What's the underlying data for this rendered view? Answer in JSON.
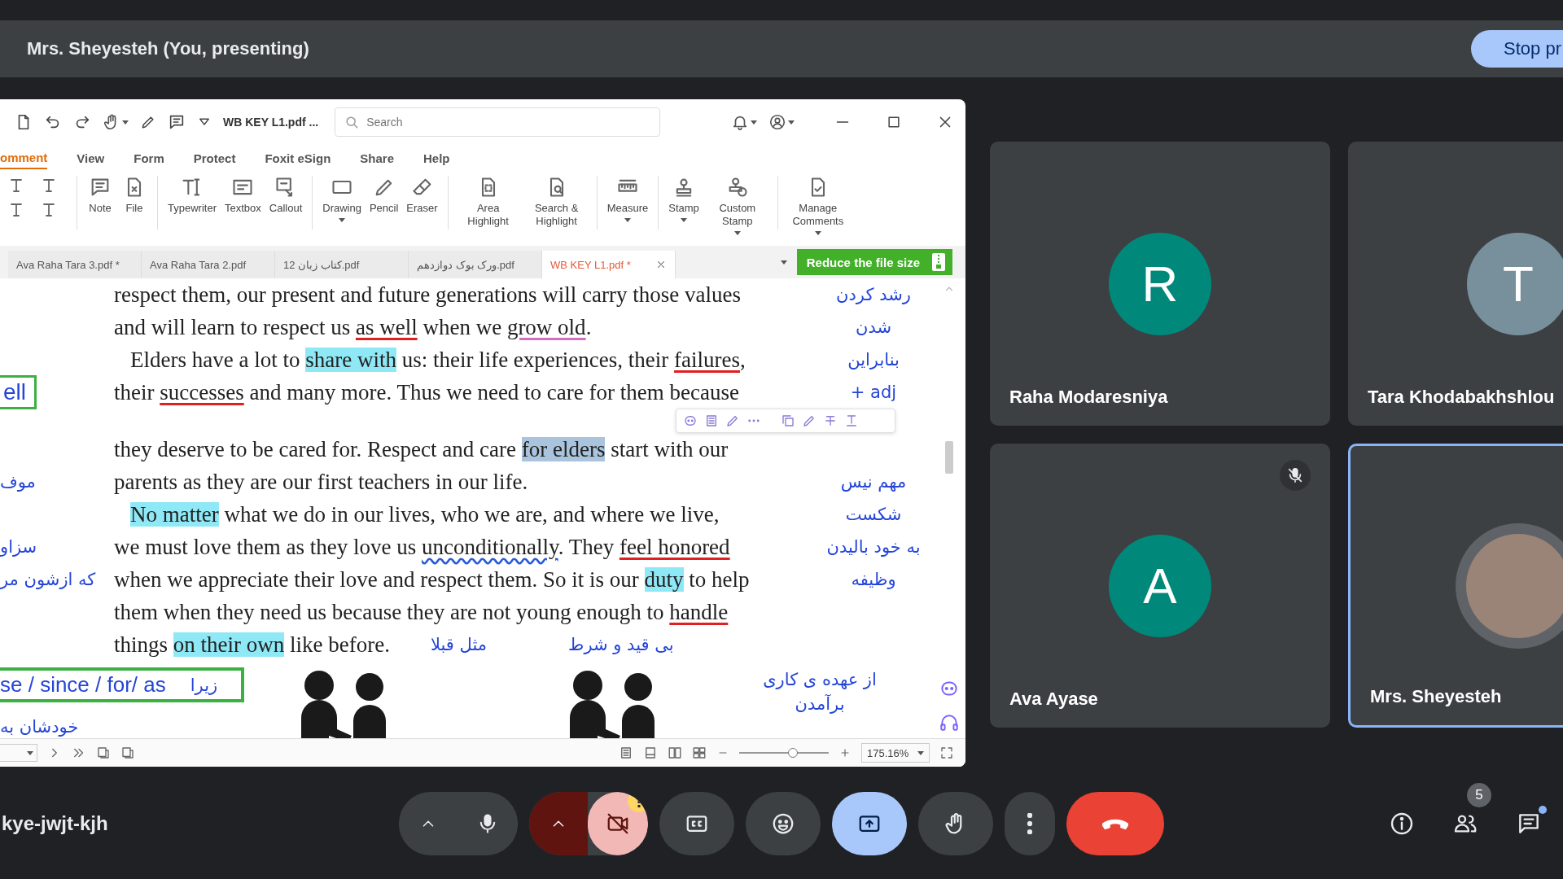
{
  "header": {
    "title": "Mrs. Sheyesteh (You, presenting)",
    "stop_button": "Stop pr"
  },
  "pdf_window": {
    "file_title": "WB KEY L1.pdf ...",
    "search": {
      "placeholder": "Search"
    },
    "menu": [
      {
        "label": "omment",
        "selected": true
      },
      {
        "label": "View",
        "selected": false
      },
      {
        "label": "Form",
        "selected": false
      },
      {
        "label": "Protect",
        "selected": false
      },
      {
        "label": "Foxit eSign",
        "selected": false
      },
      {
        "label": "Share",
        "selected": false
      },
      {
        "label": "Help",
        "selected": false
      }
    ],
    "ribbon": [
      {
        "label": "Note",
        "dropdown": false
      },
      {
        "label": "File",
        "dropdown": false
      },
      {
        "label": "Typewriter",
        "dropdown": false
      },
      {
        "label": "Textbox",
        "dropdown": false
      },
      {
        "label": "Callout",
        "dropdown": false
      },
      {
        "label": "Drawing",
        "dropdown": true
      },
      {
        "label": "Pencil",
        "dropdown": false
      },
      {
        "label": "Eraser",
        "dropdown": false
      },
      {
        "label": "Area Highlight",
        "dropdown": false
      },
      {
        "label": "Search & Highlight",
        "dropdown": false
      },
      {
        "label": "Measure",
        "dropdown": true
      },
      {
        "label": "Stamp",
        "dropdown": true
      },
      {
        "label": "Custom Stamp",
        "dropdown": true
      },
      {
        "label": "Manage Comments",
        "dropdown": true
      }
    ],
    "tabs": [
      {
        "label": "Ava Raha Tara 3.pdf *",
        "selected": false
      },
      {
        "label": "Ava Raha Tara 2.pdf",
        "selected": false
      },
      {
        "label": "کتاب زبان 12.pdf",
        "selected": false
      },
      {
        "label": "ورک بوک دوازدهم.pdf",
        "selected": false
      },
      {
        "label": "WB KEY L1.pdf *",
        "selected": true
      }
    ],
    "reduce_button": "Reduce the file size",
    "document": {
      "lines": [
        {
          "indent": false,
          "segments": [
            {
              "text": "respect them, our present and future generations will carry those values",
              "kind": "plain"
            }
          ],
          "right_note": "رشد کردن"
        },
        {
          "indent": false,
          "segments": [
            {
              "text": "and will learn to respect us ",
              "kind": "plain"
            },
            {
              "text": "as well",
              "kind": "underline",
              "color": "#e02020"
            },
            {
              "text": " when we ",
              "kind": "plain"
            },
            {
              "text": "grow old",
              "kind": "underline",
              "color": "#d070c0"
            },
            {
              "text": ".",
              "kind": "plain"
            }
          ],
          "right_note": "شدن"
        },
        {
          "indent": true,
          "segments": [
            {
              "text": "Elders have a lot to ",
              "kind": "plain"
            },
            {
              "text": "share with",
              "kind": "highlight",
              "color": "#8ee8f5"
            },
            {
              "text": " us: their life experiences, their ",
              "kind": "plain"
            },
            {
              "text": "failures",
              "kind": "underline",
              "color": "#e02020"
            },
            {
              "text": ",",
              "kind": "plain"
            }
          ],
          "right_note": "بنابراین"
        },
        {
          "indent": false,
          "segments": [
            {
              "text": "their ",
              "kind": "plain"
            },
            {
              "text": "successes",
              "kind": "underline",
              "color": "#e02020"
            },
            {
              "text": " and many more. Thus we need to care for them because",
              "kind": "plain"
            }
          ],
          "left_note": {
            "text": "ell",
            "boxed": true
          },
          "right_note": "+ adj"
        },
        {
          "indent": false,
          "segments": [
            {
              "text": "they deserve to be cared for. Respect and care ",
              "kind": "plain"
            },
            {
              "text": "for elders",
              "kind": "highlight",
              "color": "#a9c4dc"
            },
            {
              "text": " start with our",
              "kind": "plain"
            }
          ]
        },
        {
          "indent": false,
          "segments": [
            {
              "text": "parents as they are our first teachers in our life.",
              "kind": "plain"
            }
          ],
          "left_note": {
            "text": "موف",
            "boxed": false
          },
          "right_note": "مهم نیس"
        },
        {
          "indent": true,
          "segments": [
            {
              "text": "No matter",
              "kind": "highlight",
              "color": "#8ee8f5"
            },
            {
              "text": " what we do in our lives, who we are, and where we live,",
              "kind": "plain"
            }
          ],
          "right_note": "شکست"
        },
        {
          "indent": false,
          "segments": [
            {
              "text": "we must love them as they love us ",
              "kind": "plain"
            },
            {
              "text": "unconditionally",
              "kind": "squiggle",
              "color": "#2a5bd7"
            },
            {
              "text": ". They ",
              "kind": "plain"
            },
            {
              "text": "feel honored",
              "kind": "underline",
              "color": "#e02020"
            }
          ],
          "left_note": {
            "text": "سزاو",
            "boxed": false
          },
          "right_note": "به خود بالیدن"
        },
        {
          "indent": false,
          "segments": [
            {
              "text": "when we appreciate their love and respect them. So it is our ",
              "kind": "plain"
            },
            {
              "text": "duty",
              "kind": "highlight",
              "color": "#8ee8f5"
            },
            {
              "text": " to help",
              "kind": "plain"
            }
          ],
          "left_note": {
            "text": "که ازشون مر",
            "boxed": false
          },
          "right_note": "وظیفه"
        },
        {
          "indent": false,
          "segments": [
            {
              "text": "them when they need us because they are not young enough to ",
              "kind": "plain"
            },
            {
              "text": "handle",
              "kind": "underline",
              "color": "#e02020"
            }
          ]
        },
        {
          "indent": false,
          "segments": [
            {
              "text": "things ",
              "kind": "plain"
            },
            {
              "text": "on their own",
              "kind": "highlight",
              "color": "#8ee8f5"
            },
            {
              "text": " like before.",
              "kind": "plain"
            }
          ],
          "notes": [
            "بی قید و شرط",
            "مثل قبلا"
          ]
        }
      ],
      "green_box": {
        "english": "se / since / for/ as",
        "persian": "زیرا"
      },
      "bottom_left_note": "خودشان به",
      "bottom_right_note": "از عهده ی کاری برآمدن"
    },
    "status_bar": {
      "zoom": "175.16%",
      "zoom_slider": {
        "level": 0.6
      }
    }
  },
  "tiles": [
    {
      "name": "Raha Modaresniya",
      "avatar": {
        "kind": "letter",
        "letter": "R",
        "color": "#00897b"
      },
      "muted": false,
      "highlighted": false
    },
    {
      "name": "Tara Khodabakhshlou",
      "avatar": {
        "kind": "letter",
        "letter": "T",
        "color": "#78909c"
      },
      "muted": false,
      "highlighted": false
    },
    {
      "name": "Ava Ayase",
      "avatar": {
        "kind": "letter",
        "letter": "A",
        "color": "#00897b"
      },
      "muted": true,
      "highlighted": false
    },
    {
      "name": "Mrs. Sheyesteh",
      "avatar": {
        "kind": "photo"
      },
      "muted": false,
      "highlighted": true
    }
  ],
  "bottom_bar": {
    "meeting_code": "kye-jwjt-kjh",
    "controls": [
      {
        "kind": "mic",
        "on": true
      },
      {
        "kind": "camera",
        "on": false,
        "warning": true
      },
      {
        "kind": "captions",
        "on": false
      },
      {
        "kind": "reactions"
      },
      {
        "kind": "present",
        "on": true
      },
      {
        "kind": "hand",
        "on": false
      },
      {
        "kind": "more"
      },
      {
        "kind": "end"
      }
    ],
    "people_count": "5",
    "chat_unread": true
  }
}
